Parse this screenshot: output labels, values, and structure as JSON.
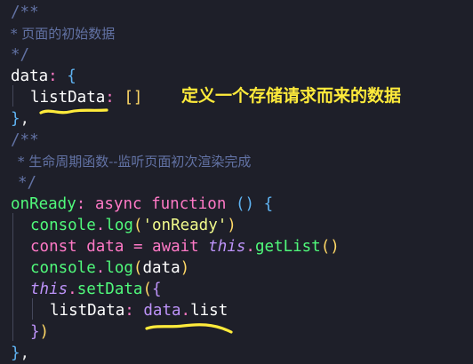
{
  "code": {
    "l1": "/**",
    "l2": "* 页面的初始数据",
    "l3": "*/",
    "l4_key": "data",
    "l4_colon": ":",
    "l4_brace": "{",
    "l5_key": "listData",
    "l5_colon": ":",
    "l5_val": "[]",
    "l6_brace": "}",
    "l6_comma": ",",
    "l7": "/**",
    "l8": "* 生命周期函数--监听页面初次渲染完成",
    "l9": "*/",
    "l10_key": "onReady",
    "l10_colon": ":",
    "l10_async": "async",
    "l10_function": "function",
    "l10_paren": "()",
    "l10_brace": "{",
    "l11_console": "console",
    "l11_dot": ".",
    "l11_log": "log",
    "l11_open": "(",
    "l11_str": "'onReady'",
    "l11_close": ")",
    "l12_const": "const",
    "l12_var": "data",
    "l12_eq": "=",
    "l12_await": "await",
    "l12_this": "this",
    "l12_dot": ".",
    "l12_fn": "getList",
    "l12_paren": "()",
    "l13_console": "console",
    "l13_dot": ".",
    "l13_log": "log",
    "l13_open": "(",
    "l13_arg": "data",
    "l13_close": ")",
    "l14_this": "this",
    "l14_dot": ".",
    "l14_fn": "setData",
    "l14_paren": "(",
    "l14_brace": "{",
    "l15_key": "listData",
    "l15_colon": ":",
    "l15_obj": "data",
    "l15_dot": ".",
    "l15_prop": "list",
    "l16_brace": "}",
    "l16_paren": ")",
    "l17_brace": "}",
    "l17_comma": ","
  },
  "annotation": {
    "text": "定义一个存储请求而来的数据",
    "color": "#ffeb3b"
  },
  "theme": {
    "background": "#1e1f29",
    "comment": "#6272a4",
    "keyword": "#ff79c6",
    "function": "#50fa7b",
    "string": "#f1fa8c",
    "brace": "#5fb3f2"
  }
}
